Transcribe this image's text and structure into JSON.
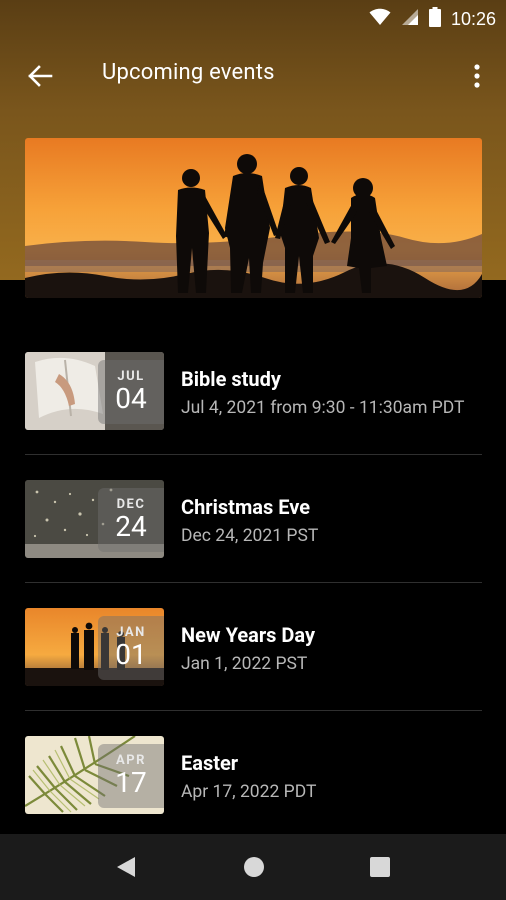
{
  "status_bar": {
    "time": "10:26",
    "icons": [
      "wifi-icon",
      "cell-signal-icon",
      "battery-icon"
    ]
  },
  "app_bar": {
    "title": "Upcoming events",
    "back_icon": "arrow-back-icon",
    "menu_icon": "more-vert-icon"
  },
  "hero": {
    "image": "family-silhouette-sunset"
  },
  "events": [
    {
      "title": "Bible study",
      "subtitle": "Jul 4, 2021 from 9:30 - 11:30am PDT",
      "month": "JUL",
      "day": "04",
      "thumb": "open-bible"
    },
    {
      "title": "Christmas Eve",
      "subtitle": "Dec 24, 2021 PST",
      "month": "DEC",
      "day": "24",
      "thumb": "christmas-lights"
    },
    {
      "title": "New Years Day",
      "subtitle": "Jan 1, 2022 PST",
      "month": "JAN",
      "day": "01",
      "thumb": "family-sunset"
    },
    {
      "title": "Easter",
      "subtitle": "Apr 17, 2022 PDT",
      "month": "APR",
      "day": "17",
      "thumb": "palm-leaf"
    }
  ],
  "nav_bar": {
    "icons": [
      "back-triangle-icon",
      "home-circle-icon",
      "recents-square-icon"
    ]
  },
  "colors": {
    "header_gradient_top": "#5a3e14",
    "header_gradient_bottom": "#93691f",
    "background": "#000000",
    "subtitle_text": "#b7b7b7",
    "nav_bar": "#1b1b1b"
  }
}
